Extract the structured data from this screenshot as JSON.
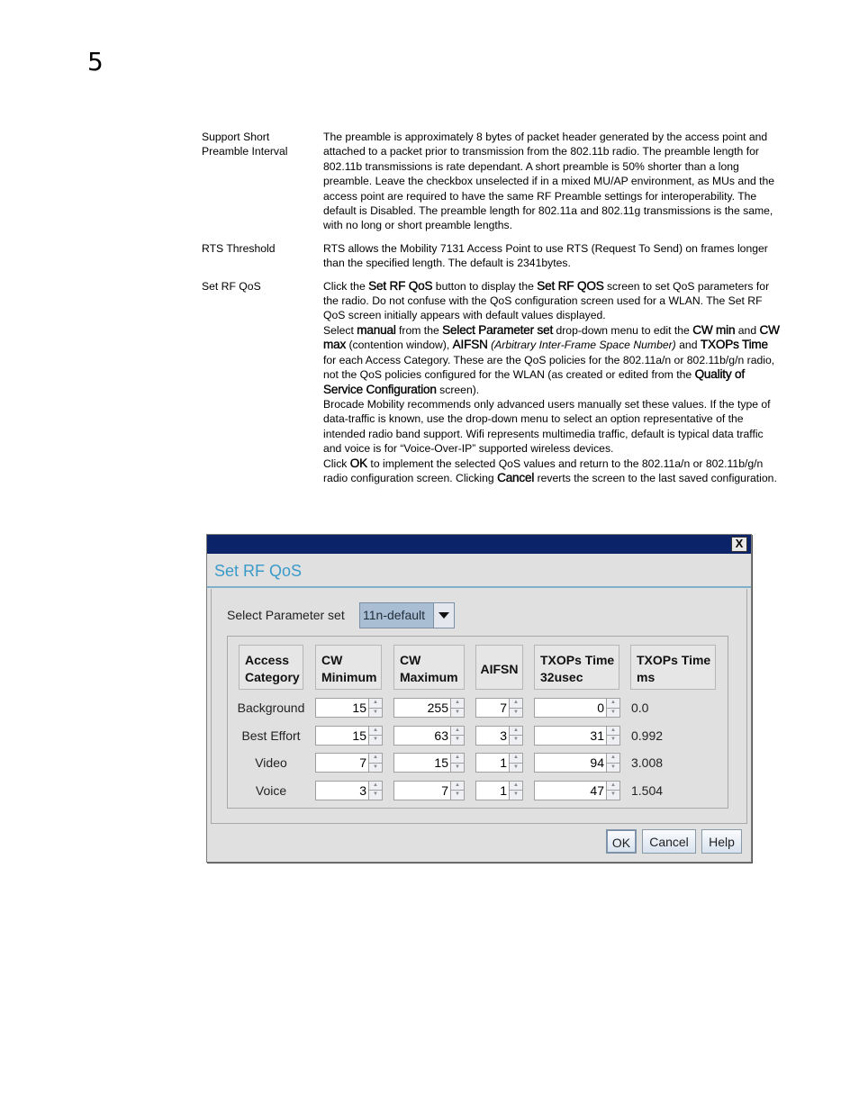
{
  "page": {
    "chapter_number": "5"
  },
  "definitions": [
    {
      "term_lines": [
        "Support Short",
        "Preamble Interval"
      ],
      "paragraphs": [
        [
          {
            "t": "The preamble is approximately 8 bytes of packet header generated by the access point and attached to a packet prior to transmission from the 802.11b radio. The preamble length for 802.11b transmissions is rate dependant. A short preamble is 50% shorter than a long preamble. Leave the checkbox unselected if in a mixed MU/AP environment, as MUs and the access point are required to have the same RF Preamble settings for interoperability. The default is Disabled. The preamble length for 802.11a and 802.11g transmissions is the same, with no long or short preamble lengths."
          }
        ]
      ]
    },
    {
      "term_lines": [
        "RTS Threshold"
      ],
      "paragraphs": [
        [
          {
            "t": "RTS allows the Mobility 7131 Access Point to use RTS (Request To Send) on frames longer than the specified length. The default is 2341bytes."
          }
        ]
      ]
    },
    {
      "term_lines": [
        "Set RF QoS"
      ],
      "paragraphs": [
        [
          {
            "t": "Click the "
          },
          {
            "t": "Set RF QoS",
            "s": "b"
          },
          {
            "t": " button to display the "
          },
          {
            "t": "Set RF QOS",
            "s": "b"
          },
          {
            "t": " screen to set QoS parameters for the radio. Do not confuse with the QoS configuration screen used for a WLAN. The Set RF QoS screen initially appears with default values displayed."
          }
        ],
        [
          {
            "t": "Select "
          },
          {
            "t": "manual",
            "s": "b"
          },
          {
            "t": " from the "
          },
          {
            "t": "Select Parameter set",
            "s": "b"
          },
          {
            "t": " drop-down menu to edit the "
          },
          {
            "t": "CW min",
            "s": "b"
          },
          {
            "t": " and "
          },
          {
            "t": "CW max",
            "s": "b"
          },
          {
            "t": " (contention window), "
          },
          {
            "t": "AIFSN",
            "s": "b"
          },
          {
            "t": " "
          },
          {
            "t": "(Arbitrary Inter-Frame Space Number)",
            "s": "i"
          },
          {
            "t": " and "
          },
          {
            "t": "TXOPs Time",
            "s": "b"
          },
          {
            "t": " for each Access Category. These are the QoS policies for the 802.11a/n or 802.11b/g/n radio, not the QoS policies configured for the WLAN (as created or edited from the "
          },
          {
            "t": "Quality of Service Configuration",
            "s": "b"
          },
          {
            "t": " screen)."
          }
        ],
        [
          {
            "t": "Brocade Mobility recommends only advanced users manually set these values. If the type of data-traffic is known, use the drop-down menu to select an option representative of the intended radio band support. Wifi represents multimedia traffic, default is typical data traffic and voice is for “Voice-Over-IP” supported wireless devices."
          }
        ],
        [
          {
            "t": "Click "
          },
          {
            "t": "OK",
            "s": "b"
          },
          {
            "t": " to implement the selected QoS values and return to the 802.11a/n or 802.11b/g/n radio configuration screen. Clicking "
          },
          {
            "t": "Cancel",
            "s": "b"
          },
          {
            "t": " reverts the screen to the last saved configuration."
          }
        ]
      ]
    }
  ],
  "dialog": {
    "close_label": "X",
    "heading": "Set RF QoS",
    "param_set_label": "Select Parameter set",
    "param_set_value": "11n-default",
    "columns": [
      "Access Category",
      "CW Minimum",
      "CW Maximum",
      "AIFSN",
      "TXOPs Time 32usec",
      "TXOPs Time ms"
    ],
    "column_lines": [
      [
        "Access",
        "Category"
      ],
      [
        "CW",
        "Minimum"
      ],
      [
        "CW",
        "Maximum"
      ],
      [
        "AIFSN"
      ],
      [
        "TXOPs Time",
        "32usec"
      ],
      [
        "TXOPs Time",
        "ms"
      ]
    ],
    "rows": [
      {
        "category": "Background",
        "cw_min": "15",
        "cw_max": "255",
        "aifsn": "7",
        "txop_32usec": "0",
        "txop_ms": "0.0"
      },
      {
        "category": "Best Effort",
        "cw_min": "15",
        "cw_max": "63",
        "aifsn": "3",
        "txop_32usec": "31",
        "txop_ms": "0.992"
      },
      {
        "category": "Video",
        "cw_min": "7",
        "cw_max": "15",
        "aifsn": "1",
        "txop_32usec": "94",
        "txop_ms": "3.008"
      },
      {
        "category": "Voice",
        "cw_min": "3",
        "cw_max": "7",
        "aifsn": "1",
        "txop_32usec": "47",
        "txop_ms": "1.504"
      }
    ],
    "buttons": {
      "ok": "OK",
      "cancel": "Cancel",
      "help": "Help"
    },
    "spin_up_glyph": "▲",
    "spin_down_glyph": "▼"
  }
}
